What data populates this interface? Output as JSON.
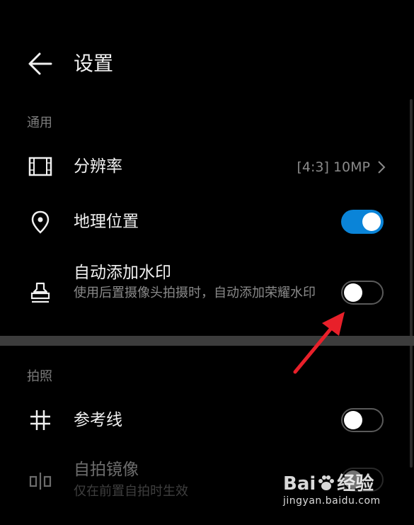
{
  "header": {
    "title": "设置"
  },
  "sections": {
    "general": "通用",
    "photo": "拍照"
  },
  "rows": {
    "resolution": {
      "label": "分辨率",
      "value": "[4:3] 10MP"
    },
    "location": {
      "label": "地理位置",
      "toggle": true
    },
    "watermark": {
      "label": "自动添加水印",
      "sub": "使用后置摄像头拍摄时，自动添加荣耀水印",
      "toggle": false
    },
    "gridlines": {
      "label": "参考线",
      "toggle": false
    },
    "mirror": {
      "label": "自拍镜像",
      "sub": "仅在前置自拍时生效",
      "toggle": false
    }
  },
  "watermark_overlay": {
    "brand": "Bai",
    "brand2": "经验",
    "url": "jingyan.baidu.com"
  },
  "colors": {
    "accent": "#0a84d8",
    "arrow": "#e8202a"
  },
  "icons": {
    "back": "arrow-left-icon",
    "resolution": "film-frame-icon",
    "location": "location-pin-icon",
    "watermark": "stamp-icon",
    "gridlines": "grid-hash-icon",
    "mirror": "mirror-icon"
  }
}
